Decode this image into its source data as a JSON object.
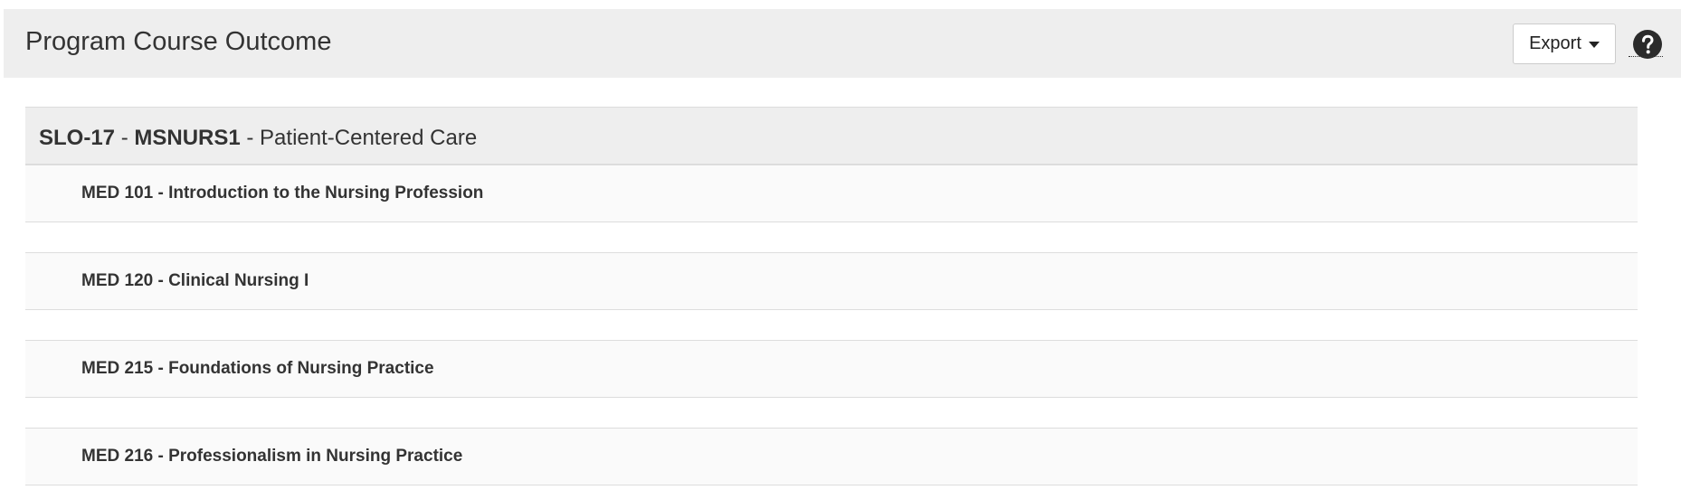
{
  "header": {
    "title": "Program Course Outcome",
    "export_label": "Export",
    "help_icon": "question-circle-icon"
  },
  "outcome": {
    "code": "SLO-17",
    "program": "MSNURS1",
    "name": "Patient-Centered Care"
  },
  "courses": [
    {
      "label": "MED 101 - Introduction to the Nursing Profession"
    },
    {
      "label": "MED 120 - Clinical Nursing I"
    },
    {
      "label": "MED 215 - Foundations of Nursing Practice"
    },
    {
      "label": "MED 216 - Professionalism in Nursing Practice"
    }
  ],
  "colors": {
    "header_bg": "#eeeeee",
    "row_bg": "#fafafa",
    "text": "#333333"
  }
}
